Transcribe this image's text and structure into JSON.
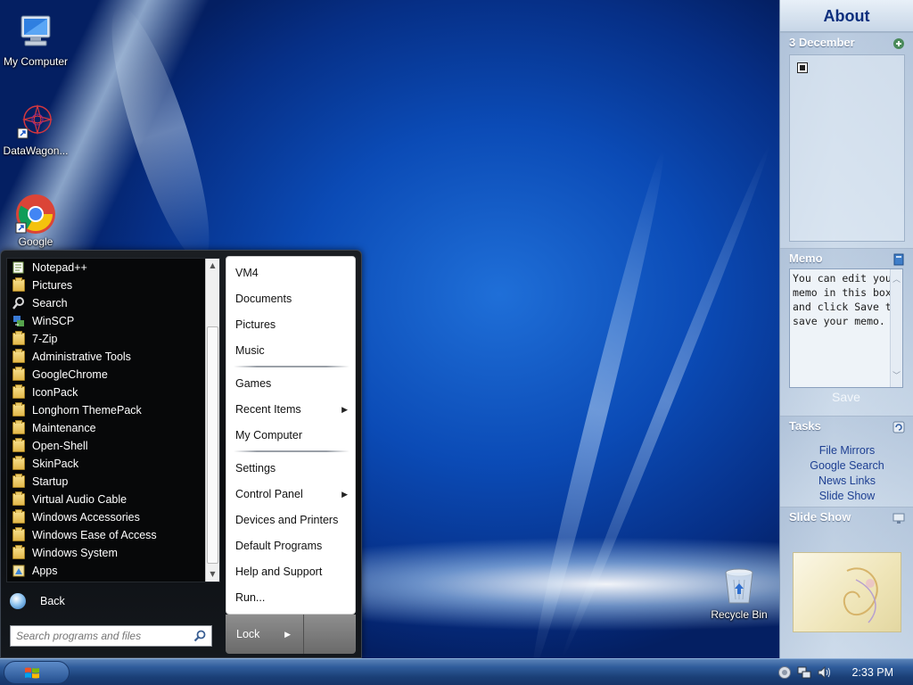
{
  "desktop": {
    "icons": [
      {
        "label": "My Computer",
        "icon": "my-computer-icon"
      },
      {
        "label": "DataWagon...",
        "icon": "datawagon-shortcut-icon"
      },
      {
        "label": "Google",
        "icon": "google-chrome-icon"
      },
      {
        "label": "Recycle Bin",
        "icon": "recycle-bin-icon"
      }
    ]
  },
  "sidebar": {
    "title": "About",
    "notes": {
      "date": "3 December"
    },
    "memo": {
      "title": "Memo",
      "text": "You can edit your memo in this box and click Save to save your memo.",
      "save_label": "Save"
    },
    "tasks": {
      "title": "Tasks",
      "links": [
        "File Mirrors",
        "Google Search",
        "News Links",
        "Slide Show"
      ]
    },
    "slideshow": {
      "title": "Slide Show"
    }
  },
  "start_menu": {
    "programs": [
      {
        "label": "Notepad++",
        "icon": "notepad-plus-plus-icon"
      },
      {
        "label": "Pictures",
        "icon": "folder-icon"
      },
      {
        "label": "Search",
        "icon": "search-icon"
      },
      {
        "label": "WinSCP",
        "icon": "winscp-icon"
      },
      {
        "label": "7-Zip",
        "icon": "folder-icon"
      },
      {
        "label": "Administrative Tools",
        "icon": "folder-icon"
      },
      {
        "label": "GoogleChrome",
        "icon": "folder-icon"
      },
      {
        "label": "IconPack",
        "icon": "folder-icon"
      },
      {
        "label": "Longhorn ThemePack",
        "icon": "folder-icon"
      },
      {
        "label": "Maintenance",
        "icon": "folder-icon"
      },
      {
        "label": "Open-Shell",
        "icon": "folder-icon"
      },
      {
        "label": "SkinPack",
        "icon": "folder-icon"
      },
      {
        "label": "Startup",
        "icon": "folder-icon"
      },
      {
        "label": "Virtual Audio Cable",
        "icon": "folder-icon"
      },
      {
        "label": "Windows Accessories",
        "icon": "folder-icon"
      },
      {
        "label": "Windows Ease of Access",
        "icon": "folder-icon"
      },
      {
        "label": "Windows System",
        "icon": "folder-icon"
      },
      {
        "label": "Apps",
        "icon": "apps-icon"
      }
    ],
    "back_label": "Back",
    "search_placeholder": "Search programs and files",
    "right_items": [
      {
        "label": "VM4"
      },
      {
        "label": "Documents"
      },
      {
        "label": "Pictures"
      },
      {
        "label": "Music"
      },
      {
        "label": "Games"
      },
      {
        "label": "Recent Items",
        "submenu": true
      },
      {
        "label": "My Computer"
      },
      {
        "label": "Settings"
      },
      {
        "label": "Control Panel",
        "submenu": true
      },
      {
        "label": "Devices and Printers"
      },
      {
        "label": "Default Programs"
      },
      {
        "label": "Help and Support"
      },
      {
        "label": "Run..."
      }
    ],
    "lock_label": "Lock"
  },
  "taskbar": {
    "clock": "2:33 PM"
  }
}
